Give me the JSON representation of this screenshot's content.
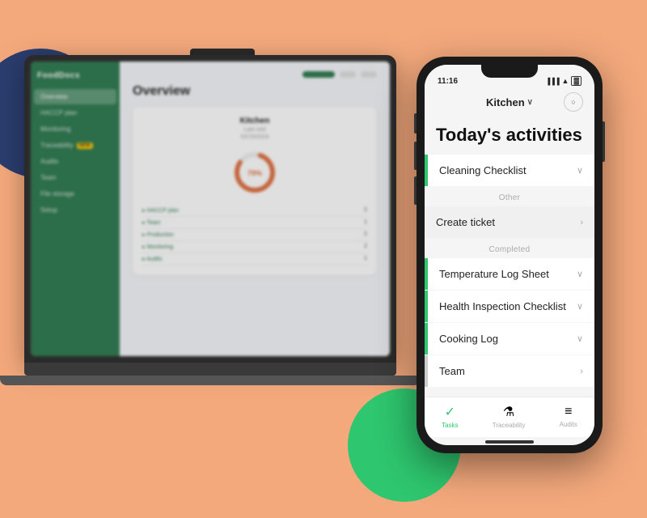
{
  "background": {
    "color": "#f4a97c"
  },
  "laptop": {
    "logo": "FoodDocs",
    "overview_title": "Overview",
    "nav_items": [
      {
        "label": "Overview",
        "active": true
      },
      {
        "label": "HACCP plan",
        "active": false
      },
      {
        "label": "Monitoring",
        "active": false
      },
      {
        "label": "Traceability",
        "active": false,
        "badge": "NEW"
      },
      {
        "label": "Audits",
        "active": false
      },
      {
        "label": "Team",
        "active": false
      },
      {
        "label": "File storage",
        "active": false
      },
      {
        "label": "Setup",
        "active": false
      }
    ],
    "card": {
      "title": "Kitchen",
      "subtitle": "Last visit",
      "date": "02/15/2024",
      "progress": "79%"
    },
    "list_items": [
      {
        "label": "HACCP plan",
        "count": "2"
      },
      {
        "label": "Team",
        "count": "1"
      },
      {
        "label": "Production",
        "count": "2"
      },
      {
        "label": "Monitoring",
        "count": "2"
      },
      {
        "label": "Audits",
        "count": "1"
      }
    ]
  },
  "phone": {
    "status_bar": {
      "time": "11:16",
      "icons": [
        "signal",
        "wifi",
        "battery"
      ]
    },
    "header": {
      "location": "Kitchen",
      "chevron": "∨",
      "avatar_icon": "○"
    },
    "page_title": "Today's activities",
    "sections": [
      {
        "items": [
          {
            "label": "Cleaning Checklist",
            "border": "green",
            "chevron": "∨",
            "type": "checklist"
          }
        ]
      },
      {
        "section_label": "Other",
        "items": [
          {
            "label": "Create ticket",
            "type": "action",
            "chevron": "›"
          }
        ]
      },
      {
        "section_label": "Completed",
        "items": [
          {
            "label": "Temperature Log Sheet",
            "border": "green",
            "chevron": "∨",
            "type": "checklist"
          },
          {
            "label": "Health Inspection Checklist",
            "border": "green",
            "chevron": "∨",
            "type": "checklist"
          },
          {
            "label": "Cooking Log",
            "border": "green",
            "chevron": "∨",
            "type": "checklist"
          },
          {
            "label": "Team",
            "border": "gray",
            "chevron": "›",
            "type": "checklist"
          }
        ]
      }
    ],
    "bottom_nav": [
      {
        "label": "Tasks",
        "icon": "✓",
        "active": true
      },
      {
        "label": "Traceability",
        "icon": "⚗",
        "active": false
      },
      {
        "label": "Audits",
        "icon": "≡",
        "active": false
      }
    ]
  }
}
